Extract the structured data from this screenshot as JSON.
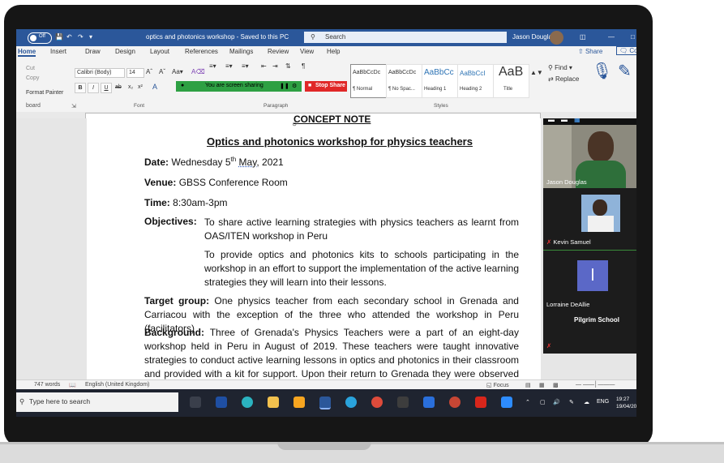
{
  "colors": {
    "word_blue": "#2b579a",
    "share_green": "#2ea043",
    "stop_red": "#e02828",
    "zoom_bg": "#222222"
  },
  "titlebar": {
    "autosave_state": "Off",
    "document_title": "optics and photonics workshop - Saved to this PC",
    "search_placeholder": "Search",
    "user_name": "Jason Douglas"
  },
  "ribbon": {
    "tabs": [
      "Home",
      "Insert",
      "Draw",
      "Design",
      "Layout",
      "References",
      "Mailings",
      "Review",
      "View",
      "Help"
    ],
    "share_label": "Share",
    "comments_label": "Cor",
    "clipboard": {
      "cut": "Cut",
      "copy": "Copy",
      "format_painter": "Format Painter",
      "group": "board"
    },
    "font": {
      "family": "Calibri (Body)",
      "size": "14",
      "group": "Font"
    },
    "paragraph_group": "Paragraph",
    "screen_share_text": "You are screen sharing",
    "stop_share_label": "Stop Share",
    "styles": [
      {
        "sample": "AaBbCcDc",
        "name": "¶ Normal"
      },
      {
        "sample": "AaBbCcDc",
        "name": "¶ No Spac..."
      },
      {
        "sample": "AaBbCc",
        "name": "Heading 1"
      },
      {
        "sample": "AaBbCcI",
        "name": "Heading 2"
      },
      {
        "sample": "AaB",
        "name": "Title"
      }
    ],
    "styles_group": "Styles",
    "find_label": "Find",
    "replace_label": "Replace"
  },
  "document": {
    "partial_heading": "CONCEPT NOTE",
    "title": "Optics and photonics workshop for physics teachers",
    "date_label": "Date:",
    "date_value_pre": "Wednesday 5",
    "date_value_sup": "th",
    "date_value_month": "May,",
    "date_value_year": "2021",
    "venue_label": "Venue:",
    "venue_value": "GBSS Conference Room",
    "time_label": "Time:",
    "time_value": "8:30am-3pm",
    "objectives_label": "Objectives:",
    "objective_1": "To share active learning strategies with physics teachers as learnt from OAS/ITEN workshop in Peru",
    "objective_2": "To provide optics and photonics kits to schools participating in the workshop in an effort to support the implementation of the active learning strategies they will learn into their lessons.",
    "target_label": "Target group:",
    "target_text": "One physics teacher from each secondary school in Grenada and Carriacou with the exception of the three who attended the workshop in Peru (facilitators)",
    "background_label": "Background:",
    "background_text": "Three of Grenada's Physics Teachers were a part of an eight-day workshop held in Peru in August of 2019. These teachers were taught innovative strategies to conduct active learning lessons in optics and photonics in their classroom and provided with a kit for support. Upon their return to Grenada they were observed during their lessons to see the strategies"
  },
  "zoom": {
    "participants": [
      {
        "name": "Jason Douglas"
      },
      {
        "name": "Kevin Samuel"
      },
      {
        "name": "Lorraine DeAllie",
        "initial": "l"
      },
      {
        "name": "Pilgrim School"
      }
    ]
  },
  "statusbar": {
    "words": "747 words",
    "language": "English (United Kingdom)",
    "focus": "Focus"
  },
  "taskbar": {
    "search_placeholder": "Type here to search",
    "lang": "ENG",
    "time": "19:27",
    "date": "19/04/202"
  }
}
